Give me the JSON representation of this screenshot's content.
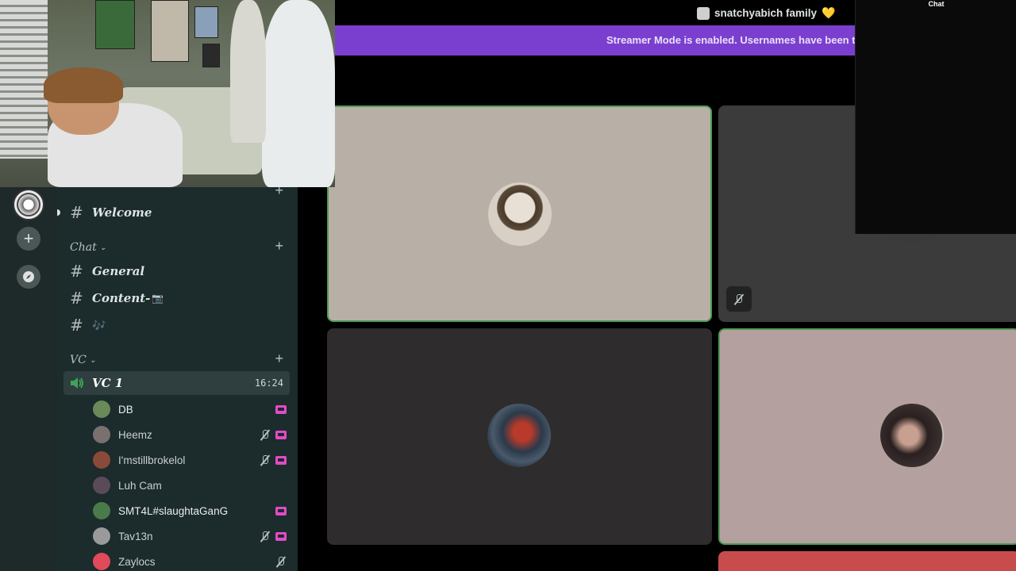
{
  "header": {
    "server_title": "snatchyabich family",
    "title_emoji": "💛",
    "streamer_banner": "Streamer Mode is enabled. Usernames have been tr"
  },
  "chat_overlay": {
    "title": "Chat"
  },
  "channels": {
    "welcome": "Welcome",
    "categories": {
      "chat": "Chat",
      "vc": "VC"
    },
    "chat_channels": [
      {
        "name": "General"
      },
      {
        "name": "Content-",
        "emoji": "📷"
      },
      {
        "name": "",
        "emoji": "🎶"
      }
    ],
    "voice_channel": {
      "name": "VC 1",
      "timer": "16:24"
    },
    "voice_users": [
      {
        "name": "DB",
        "muted": false,
        "streaming": true,
        "avatar_color": "#6a8a5a"
      },
      {
        "name": "Heemz",
        "muted": true,
        "streaming": true,
        "avatar_color": "#7a7070"
      },
      {
        "name": "I'mstillbrokelol",
        "muted": true,
        "streaming": true,
        "avatar_color": "#8a4a3a"
      },
      {
        "name": "Luh Cam",
        "muted": false,
        "streaming": false,
        "avatar_color": "#5a4a5a"
      },
      {
        "name": "SMT4L#slaughtaGanG",
        "muted": false,
        "streaming": true,
        "avatar_color": "#4a7a4a"
      },
      {
        "name": "Tav13n",
        "muted": true,
        "streaming": true,
        "avatar_color": "#9a9a9a"
      },
      {
        "name": "Zaylocs",
        "muted": true,
        "streaming": false,
        "avatar_color": "#e04a5a"
      }
    ]
  },
  "colors": {
    "accent_purple": "#7b3fd0",
    "speaking_green": "#4e9a54",
    "stream_pink": "#e14bc5",
    "sidebar_bg": "#1c2b2c"
  }
}
